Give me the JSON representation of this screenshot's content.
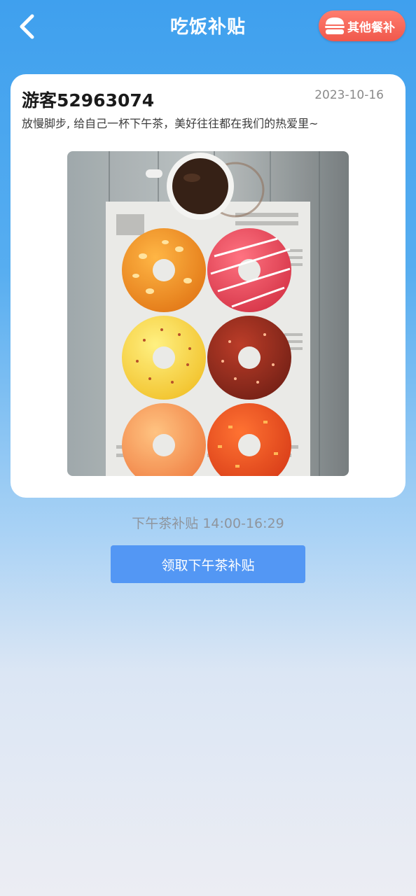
{
  "header": {
    "title": "吃饭补贴",
    "other_button_label": "其他餐补",
    "back_icon": "chevron-left-icon",
    "burger_icon": "burger-icon"
  },
  "card": {
    "username": "游客52963074",
    "date": "2023-10-16",
    "slogan": "放慢脚步, 给自己一杯下午茶，美好往往都在我们的热爱里~",
    "image": "coffee-and-donuts-illustration"
  },
  "subsidy": {
    "time_text": "下午茶补贴 14:00-16:29",
    "claim_button_label": "领取下午茶补贴"
  },
  "colors": {
    "header_blue": "#3fa0ee",
    "button_blue": "#5397f4",
    "other_button_red": "#f0584c"
  }
}
